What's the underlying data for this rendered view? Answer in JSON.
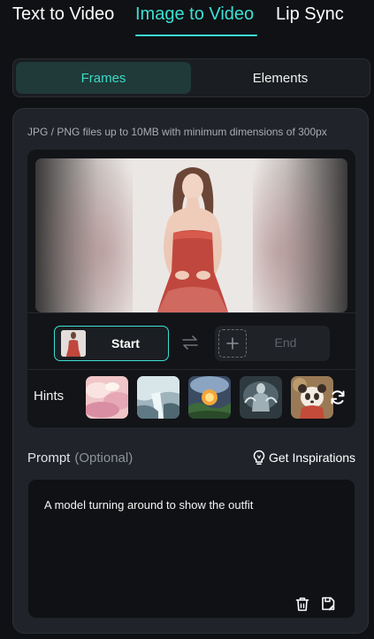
{
  "top_tabs": [
    {
      "label": "Text to Video",
      "active": false
    },
    {
      "label": "Image to Video",
      "active": true
    },
    {
      "label": "Lip Sync",
      "active": false
    }
  ],
  "segment": {
    "frames": "Frames",
    "elements": "Elements",
    "selected": "Frames"
  },
  "upload": {
    "requirements": "JPG / PNG files up to 10MB with minimum dimensions of 300px",
    "start_label": "Start",
    "end_label": "End"
  },
  "hints": {
    "label": "Hints",
    "thumbnails": [
      "pink-clouds-thumbnail",
      "icy-waterfall-thumbnail",
      "glowing-landscape-thumbnail",
      "misty-figure-thumbnail",
      "panda-thumbnail"
    ]
  },
  "prompt": {
    "label": "Prompt",
    "optional": "(Optional)",
    "inspirations": "Get Inspirations",
    "text": "A model turning around to show the outfit"
  },
  "colors": {
    "accent": "#3ce0d4",
    "background": "#0f1114",
    "panel": "#20242a"
  }
}
